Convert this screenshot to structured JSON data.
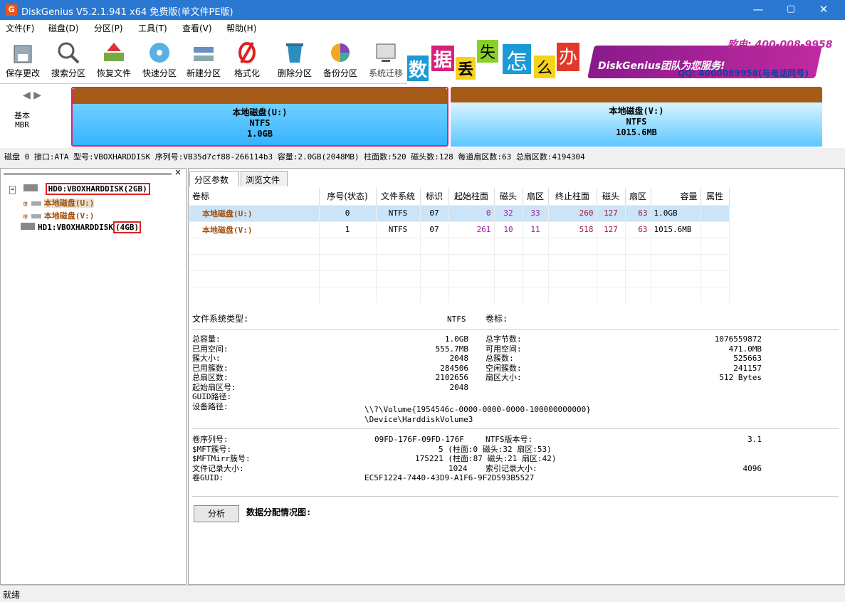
{
  "window": {
    "title": "DiskGenius V5.2.1.941 x64 免费版(单文件PE版)",
    "app_icon": "G",
    "min": "—",
    "max": "▢",
    "close": "✕"
  },
  "menu": [
    "文件(F)",
    "磁盘(D)",
    "分区(P)",
    "工具(T)",
    "查看(V)",
    "帮助(H)"
  ],
  "toolbar": [
    "保存更改",
    "搜索分区",
    "恢复文件",
    "快速分区",
    "新建分区",
    "格式化",
    "删除分区",
    "备份分区",
    "系统迁移"
  ],
  "banner": {
    "chars": [
      "数",
      "据",
      "丢",
      "失",
      "怎",
      "么",
      "办"
    ],
    "brand": "DiskGenius团队为您服务!",
    "phone": "致电: 400-008-9958",
    "qq": "QQ: 4000089958(与电话同号)"
  },
  "diskmap": {
    "arrows": "◀ ▶",
    "basic": "基本",
    "mbr": "MBR",
    "parts": [
      {
        "name": "本地磁盘(U:)",
        "fs": "NTFS",
        "size": "1.0GB"
      },
      {
        "name": "本地磁盘(V:)",
        "fs": "NTFS",
        "size": "1015.6MB"
      }
    ]
  },
  "diskinfo": "磁盘 0 接口:ATA  型号:VBOXHARDDISK  序列号:VB35d7cf88-266114b3  容量:2.0GB(2048MB)  柱面数:520  磁头数:128  每道扇区数:63  总扇区数:4194304",
  "tree": {
    "close": "×",
    "hd0": "HD0:VBOXHARDDISK(2GB)",
    "u": "本地磁盘(U:)",
    "v": "本地磁盘(V:)",
    "hd1_name": "HD1:VBOXHARDDISK",
    "hd1_size": "(4GB)"
  },
  "tabs": [
    "分区参数",
    "浏览文件"
  ],
  "table": {
    "headers": [
      "卷标",
      "序号(状态)",
      "文件系统",
      "标识",
      "起始柱面",
      "磁头",
      "扇区",
      "终止柱面",
      "磁头",
      "扇区",
      "容量",
      "属性"
    ],
    "rows": [
      [
        "本地磁盘(U:)",
        "0",
        "NTFS",
        "07",
        "0",
        "32",
        "33",
        "260",
        "127",
        "63",
        "1.0GB",
        ""
      ],
      [
        "本地磁盘(V:)",
        "1",
        "NTFS",
        "07",
        "261",
        "10",
        "11",
        "518",
        "127",
        "63",
        "1015.6MB",
        ""
      ]
    ]
  },
  "details": {
    "fs_type_label": "文件系统类型:",
    "fs_type": "NTFS",
    "vol_label": "卷标:",
    "left_labels": [
      "总容量:",
      "已用空间:",
      "簇大小:",
      "已用簇数:",
      "总扇区数:",
      "起始扇区号:",
      "GUID路径:",
      "设备路径:"
    ],
    "left_values": [
      "1.0GB",
      "555.7MB",
      "2048",
      "284506",
      "2102656",
      "2048"
    ],
    "guid_path": "\\\\?\\Volume{1954546c-0000-0000-0000-100000000000}",
    "device_path": "\\Device\\HarddiskVolume3",
    "right_labels": [
      "总字节数:",
      "可用空间:",
      "总簇数:",
      "空闲簇数:",
      "扇区大小:"
    ],
    "right_values": [
      "1076559872",
      "471.0MB",
      "525663",
      "241157",
      "512 Bytes"
    ],
    "serial_label": "卷序列号:",
    "serial": "09FD-176F-09FD-176F",
    "ntfs_ver_label": "NTFS版本号:",
    "ntfs_ver": "3.1",
    "mft_label": "$MFT簇号:",
    "mft": "5 (柱面:0 磁头:32 扇区:53)",
    "mftmirr_label": "$MFTMirr簇号:",
    "mftmirr": "175221 (柱面:87 磁头:21 扇区:42)",
    "rec_label": "文件记录大小:",
    "rec": "1024",
    "idx_label": "索引记录大小:",
    "idx": "4096",
    "guid_label": "卷GUID:",
    "guid": "EC5F1224-7440-43D9-A1F6-9F2D593B5527"
  },
  "analyze": {
    "button": "分析",
    "label": "数据分配情况图:"
  },
  "status": "就绪"
}
